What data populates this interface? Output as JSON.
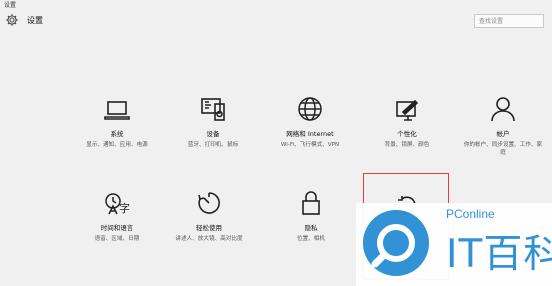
{
  "window": {
    "title": "设置"
  },
  "header": {
    "title": "设置",
    "icon": "gear-icon"
  },
  "search": {
    "placeholder": "查找设置"
  },
  "tiles": [
    {
      "icon": "laptop-icon",
      "name": "系统",
      "desc": "显示、通知、应用、电源"
    },
    {
      "icon": "devices-icon",
      "name": "设备",
      "desc": "蓝牙、打印机、鼠标"
    },
    {
      "icon": "globe-icon",
      "name": "网络和 Internet",
      "desc": "Wi-Fi、飞行模式、VPN"
    },
    {
      "icon": "paint-icon",
      "name": "个性化",
      "desc": "背景、锁屏、颜色"
    },
    {
      "icon": "person-icon",
      "name": "帐户",
      "desc": "你的帐户、同步设置、工作、家庭"
    },
    {
      "icon": "language-icon",
      "name": "时间和语言",
      "desc": "语音、区域、日期"
    },
    {
      "icon": "timer-icon",
      "name": "轻松使用",
      "desc": "讲述人、放大镜、高对比度"
    },
    {
      "icon": "lock-icon",
      "name": "隐私",
      "desc": "位置、相机"
    },
    {
      "icon": "refresh-icon",
      "name": "",
      "desc": ""
    }
  ],
  "watermark": {
    "brand_small": "PConline",
    "brand_big": "IT百科",
    "color": "#2a8fd4"
  },
  "colors": {
    "highlight": "#e03c3c",
    "background": "#f0f0f0"
  }
}
